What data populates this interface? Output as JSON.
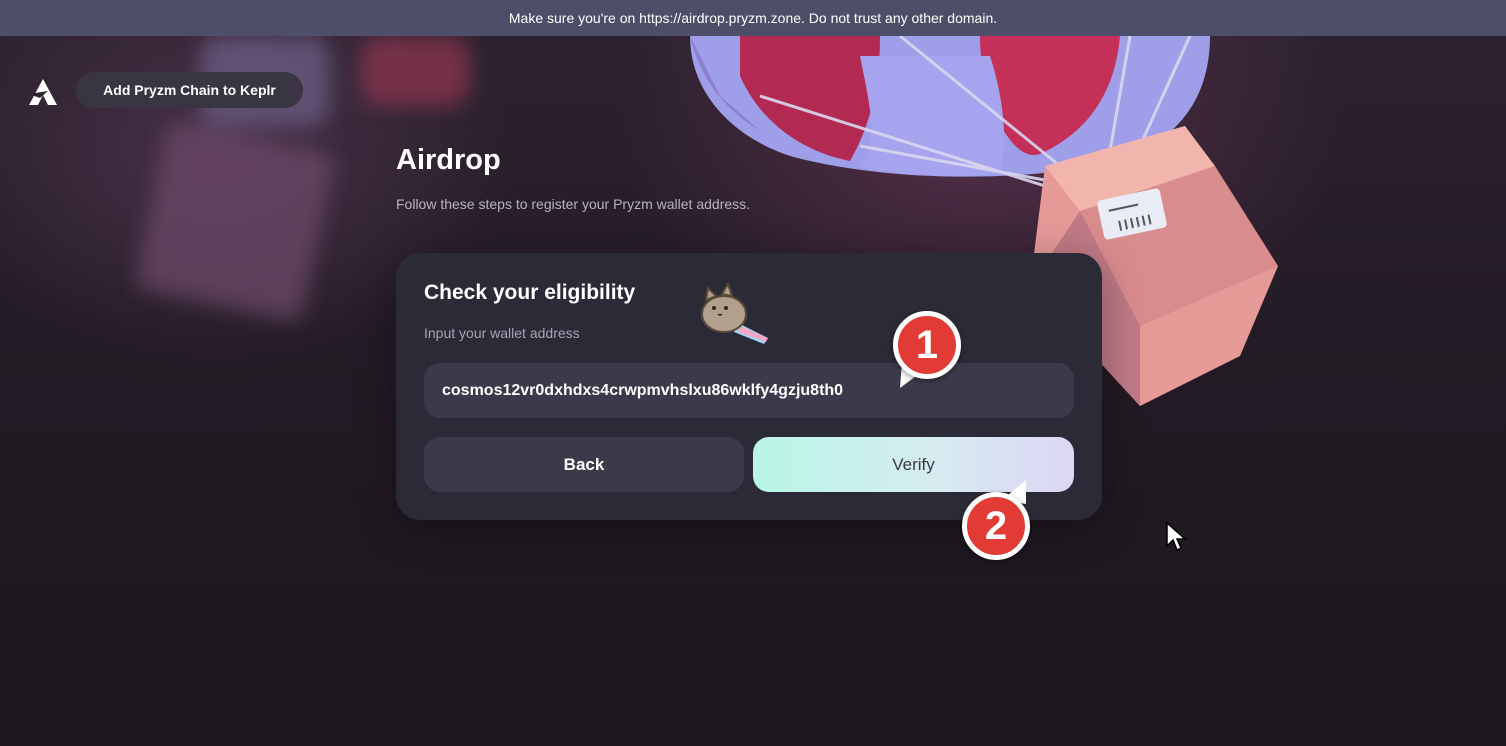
{
  "banner": {
    "text": "Make sure you're on https://airdrop.pryzm.zone. Do not trust any other domain."
  },
  "header": {
    "logo_icon": "pryzm-logo-icon",
    "keplr_button_label": "Add Pryzm Chain to Keplr"
  },
  "page": {
    "title": "Airdrop",
    "subtitle": "Follow these steps to register your Pryzm wallet address."
  },
  "card": {
    "title": "Check your eligibility",
    "input_label": "Input your wallet address",
    "wallet_address": "cosmos12vr0dxhdxs4crwpmvhslxu86wklfy4gzju8th0",
    "back_label": "Back",
    "verify_label": "Verify"
  },
  "markers": {
    "step1": "1",
    "step2": "2"
  },
  "colors": {
    "banner_bg": "#4d4e68",
    "card_bg": "#2b2a37",
    "input_bg": "#3b3a4b",
    "verify_gradient_start": "#b8f6e6",
    "verify_gradient_end": "#ddd6f5",
    "marker_red": "#e23a35"
  }
}
